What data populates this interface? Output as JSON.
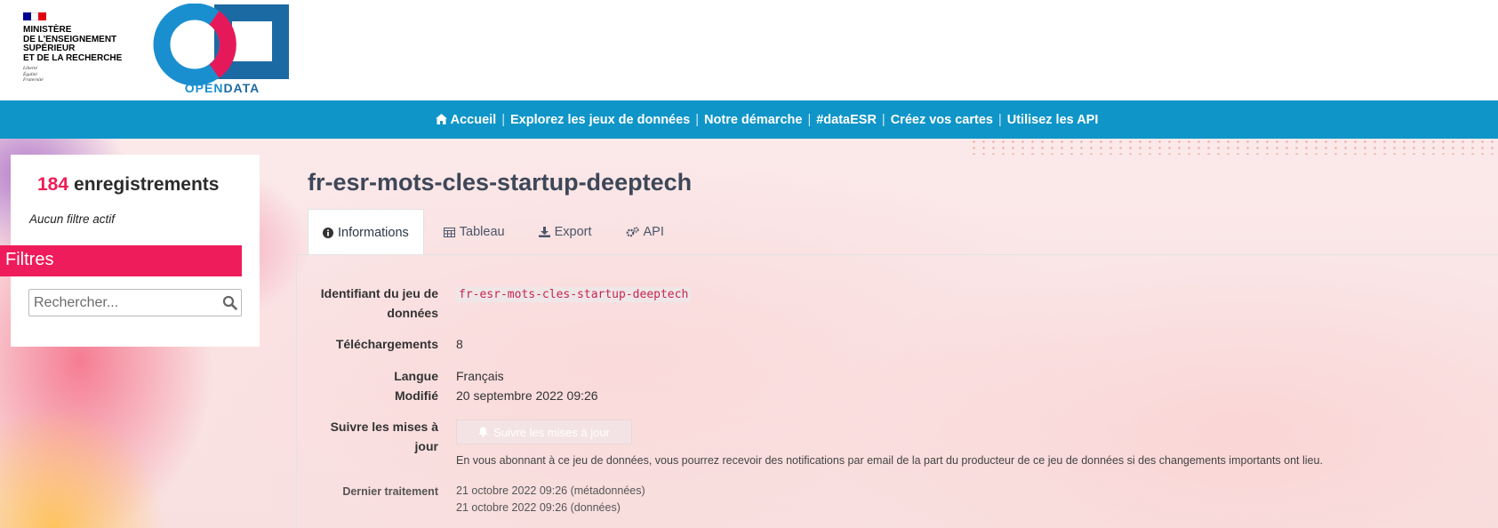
{
  "header": {
    "ministry_name": [
      "MINISTÈRE",
      "DE L'ENSEIGNEMENT",
      "SUPÉRIEUR",
      "ET DE LA RECHERCHE"
    ],
    "ministry_motto": [
      "Liberté",
      "Égalité",
      "Fraternité"
    ],
    "logo_text_open": "OPEN",
    "logo_text_data": "DATA"
  },
  "nav": {
    "items": [
      "Accueil",
      "Explorez les jeux de données",
      "Notre démarche",
      "#dataESR",
      "Créez vos cartes",
      "Utilisez les API"
    ],
    "separator": "|"
  },
  "sidebar": {
    "record_count": "184",
    "record_label": "enregistrements",
    "filter_status": "Aucun filtre actif",
    "filters_title": "Filtres",
    "search_placeholder": "Rechercher..."
  },
  "main": {
    "title": "fr-esr-mots-cles-startup-deeptech",
    "tabs": [
      "Informations",
      "Tableau",
      "Export",
      "API"
    ],
    "fields": {
      "identifier_label_1": "Identifiant du jeu de",
      "identifier_label_2": "données",
      "identifier_value": "fr-esr-mots-cles-startup-deeptech",
      "downloads_label": "Téléchargements",
      "downloads_value": "8",
      "language_label": "Langue",
      "language_value": "Français",
      "modified_label": "Modifié",
      "modified_value": "20 septembre 2022 09:26",
      "follow_label_1": "Suivre les mises à",
      "follow_label_2": "jour",
      "follow_button": "Suivre les mises à jour",
      "follow_note": "En vous abonnant à ce jeu de données, vous pourrez recevoir des notifications par email de la part du producteur de ce jeu de données si des changements importants ont lieu.",
      "last_processing_label": "Dernier traitement",
      "last_processing_meta": "21 octobre 2022 09:26 (métadonnées)",
      "last_processing_data": "21 octobre 2022 09:26 (données)"
    }
  },
  "colors": {
    "nav_bg": "#0f95c8",
    "accent_pink": "#ee1c5a",
    "title_color": "#3d4758",
    "logo_blue": "#1a8fd0",
    "logo_dark_blue": "#1c6aa3"
  }
}
